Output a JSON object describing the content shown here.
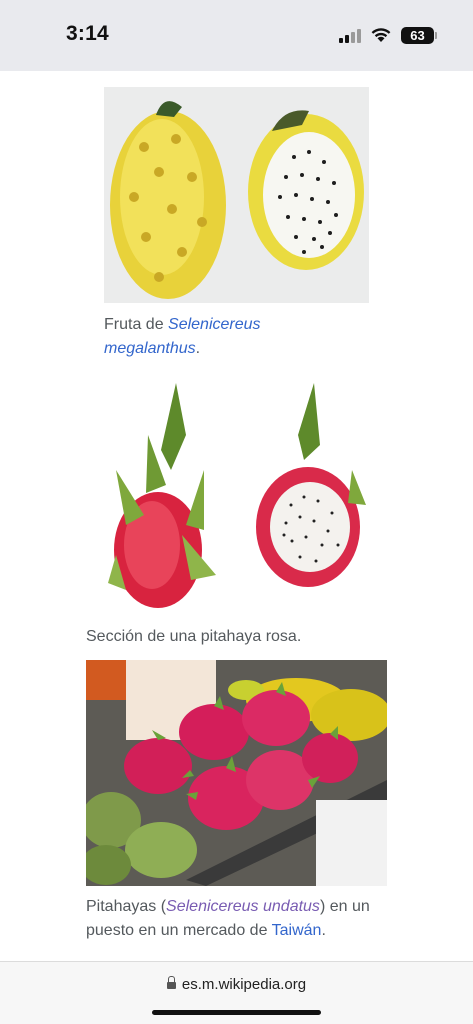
{
  "status_bar": {
    "time": "3:14",
    "battery": "63",
    "icons": [
      "signal-icon",
      "wifi-icon",
      "battery-icon"
    ]
  },
  "figures": [
    {
      "image": "yellow-pitahaya-photo",
      "caption_prefix": "Fruta de ",
      "caption_link": "Selenicereus megalanthus",
      "caption_suffix": "."
    },
    {
      "image": "pink-pitahaya-photo",
      "caption": "Sección de una pitahaya rosa."
    },
    {
      "image": "market-pitahayas-photo",
      "caption_prefix": "Pitahayas (",
      "caption_link": "Selenicereus undatus",
      "caption_middle": ") en un puesto en un mercado de ",
      "caption_link2": "Taiwán",
      "caption_suffix": "."
    }
  ],
  "browser": {
    "url": "es.m.wikipedia.org",
    "icons": [
      "lock-icon"
    ]
  },
  "colors": {
    "link": "#3366cc",
    "visited_link": "#795cb2",
    "caption_text": "#54595d",
    "status_bar_bg": "#e9eaee"
  }
}
